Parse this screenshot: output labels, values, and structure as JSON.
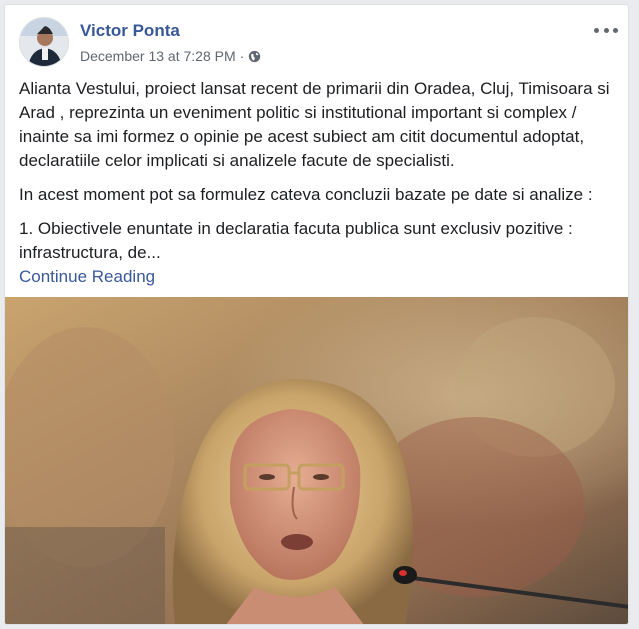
{
  "post": {
    "author": "Victor Ponta",
    "timestamp": "December 13 at 7:28 PM",
    "separator": "·",
    "privacy_icon": "globe-icon",
    "more_icon": "more-options-icon",
    "paragraphs": [
      "Alianta Vestului, proiect lansat recent de primarii din Oradea, Cluj, Timisoara si Arad , reprezinta un eveniment politic si institutional important si complex / inainte sa imi formez o opinie pe acest subiect am citit documentul adoptat, declaratiile celor implicati si analizele facute de specialisti.",
      "In acest moment pot sa formulez cateva concluzii bazate pe date si analize :",
      "1. Obiectivele enuntate in declaratia facuta publica sunt exclusiv pozitive : infrastructura, de..."
    ],
    "continue_label": "Continue Reading"
  },
  "colors": {
    "link": "#385898",
    "body_text": "#1c1e21",
    "meta_text": "#606770",
    "page_bg": "#e9ebee"
  }
}
